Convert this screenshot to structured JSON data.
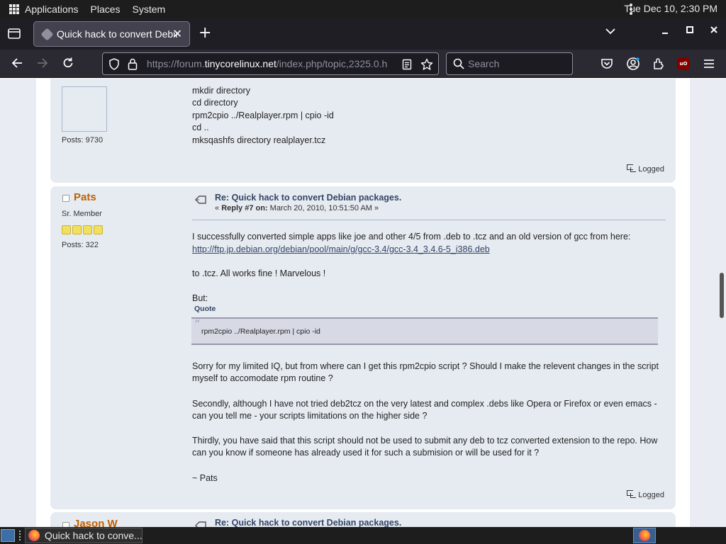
{
  "top_panel": {
    "menus": [
      "Applications",
      "Places",
      "System"
    ],
    "clock": "Tue Dec 10,  2:30 PM"
  },
  "browser": {
    "tab_title": "Quick hack to convert Debia",
    "url_host": "https://forum.",
    "url_domain": "tinycorelinux.net",
    "url_path": "/index.php/topic,2325.0.h",
    "search_placeholder": "Search",
    "ublock_label": "uO"
  },
  "posts": {
    "prev": {
      "code_lines": [
        "mkdir directory",
        "cd directory",
        "rpm2cpio ../Realplayer.rpm | cpio -id",
        "cd ..",
        "mksqashfs directory realplayer.tcz"
      ],
      "posts_count": "Posts: 9730",
      "logged": "Logged"
    },
    "current": {
      "poster_name": "Pats",
      "rank": "Sr. Member",
      "stars": 4,
      "posts_count": "Posts: 322",
      "subject": "Re: Quick hack to convert Debian packages.",
      "meta_prefix": "« ",
      "meta_reply": "Reply #7 on:",
      "meta_date": " March 20, 2010, 10:51:50 AM »",
      "para1": "I successfully converted simple apps like joe and other 4/5 from .deb to .tcz and an old version of gcc from here:",
      "link": "http://ftp.jp.debian.org/debian/pool/main/g/gcc-3.4/gcc-3.4_3.4.6-5_i386.deb",
      "para2": "to .tcz. All works fine ! Marvelous !",
      "para3": "But:",
      "quote_header": "Quote",
      "quote_text": "rpm2cpio ../Realplayer.rpm | cpio -id",
      "para4": "Sorry for my limited IQ, but from where can I get this rpm2cpio script ? Should I make the relevent changes in the script myself to accomodate rpm routine ?",
      "para5": "Secondly, although I have not tried deb2tcz on the very latest and complex .debs like Opera or Firefox or even emacs - can you tell me - your scripts limitations on the higher side ?",
      "para6": "Thirdly, you have said that this script should not be used to submit any deb to tcz converted extension to the repo. How can you know if someone has already used it for such a submision or will be used for it ?",
      "signature": "~ Pats",
      "logged": "Logged"
    },
    "next": {
      "poster_name": "Jason W",
      "subject": "Re: Quick hack to convert Debian packages."
    }
  },
  "taskbar": {
    "task_label": "Quick hack to conve..."
  }
}
